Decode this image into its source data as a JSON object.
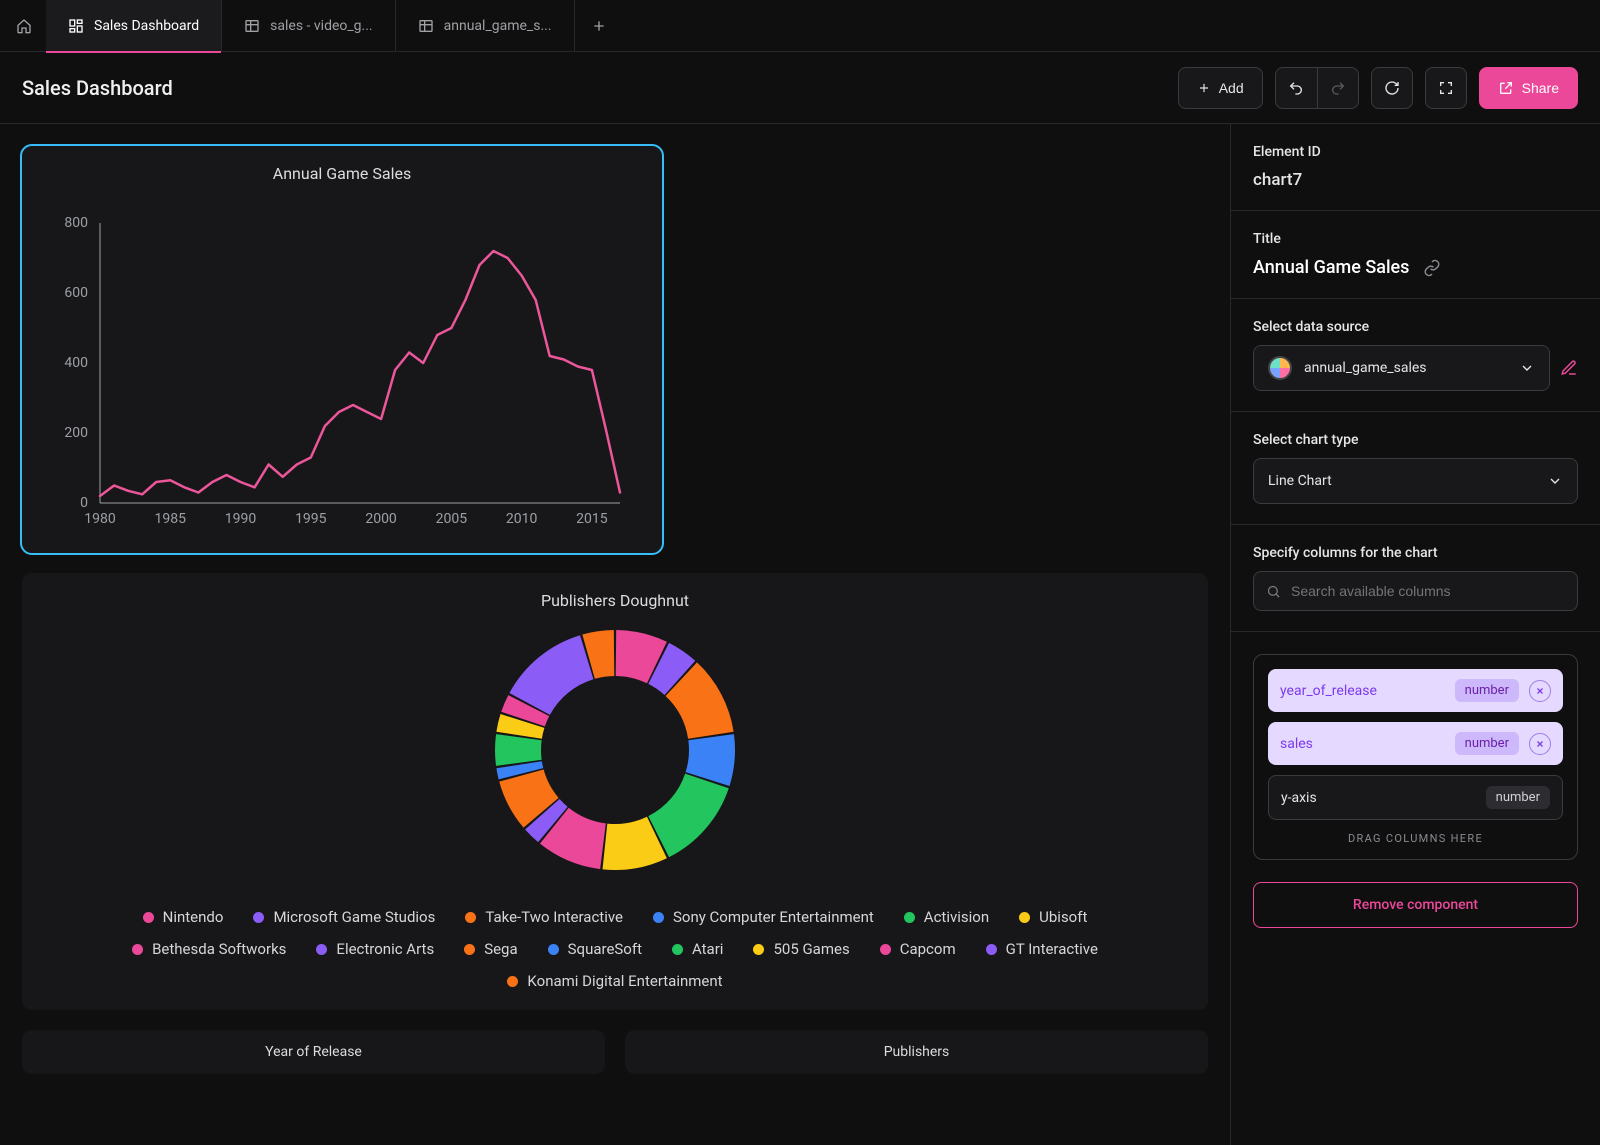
{
  "tabs": {
    "home_icon": "home-icon",
    "items": [
      {
        "label": "Sales Dashboard",
        "icon": "dashboard-icon",
        "active": true
      },
      {
        "label": "sales - video_g...",
        "icon": "table-icon",
        "active": false
      },
      {
        "label": "annual_game_s...",
        "icon": "table-icon",
        "active": false
      }
    ],
    "add_label": "+"
  },
  "header": {
    "title": "Sales Dashboard",
    "add_label": "Add",
    "share_label": "Share"
  },
  "sidebar": {
    "element_id": {
      "label": "Element ID",
      "value": "chart7"
    },
    "title": {
      "label": "Title",
      "value": "Annual Game Sales"
    },
    "datasource": {
      "label": "Select data source",
      "value": "annual_game_sales"
    },
    "charttype": {
      "label": "Select chart type",
      "value": "Line Chart"
    },
    "columns": {
      "label": "Specify columns for the chart",
      "search_placeholder": "Search available columns"
    },
    "well": {
      "chips": [
        {
          "name": "year_of_release",
          "type": "number"
        },
        {
          "name": "sales",
          "type": "number"
        }
      ],
      "axis": {
        "name": "y-axis",
        "type": "number"
      },
      "drag_hint": "DRAG COLUMNS HERE"
    },
    "remove_label": "Remove component"
  },
  "charts": {
    "line": {
      "title": "Annual Game Sales",
      "y_ticks": [
        0,
        200,
        400,
        600,
        800
      ],
      "x_ticks": [
        1980,
        1985,
        1990,
        1995,
        2000,
        2005,
        2010,
        2015
      ]
    },
    "doughnut": {
      "title": "Publishers Doughnut",
      "legend": [
        {
          "label": "Nintendo",
          "color": "#ec4899"
        },
        {
          "label": "Microsoft Game Studios",
          "color": "#8b5cf6"
        },
        {
          "label": "Take-Two Interactive",
          "color": "#f97316"
        },
        {
          "label": "Sony Computer Entertainment",
          "color": "#3b82f6"
        },
        {
          "label": "Activision",
          "color": "#22c55e"
        },
        {
          "label": "Ubisoft",
          "color": "#facc15"
        },
        {
          "label": "Bethesda Softworks",
          "color": "#ec4899"
        },
        {
          "label": "Electronic Arts",
          "color": "#8b5cf6"
        },
        {
          "label": "Sega",
          "color": "#f97316"
        },
        {
          "label": "SquareSoft",
          "color": "#3b82f6"
        },
        {
          "label": "Atari",
          "color": "#22c55e"
        },
        {
          "label": "505 Games",
          "color": "#facc15"
        },
        {
          "label": "Capcom",
          "color": "#ec4899"
        },
        {
          "label": "GT Interactive",
          "color": "#8b5cf6"
        },
        {
          "label": "Konami Digital Entertainment",
          "color": "#f97316"
        }
      ]
    },
    "bottom": {
      "left": "Year of Release",
      "right": "Publishers"
    }
  },
  "chart_data": [
    {
      "type": "line",
      "title": "Annual Game Sales",
      "xlabel": "",
      "ylabel": "",
      "ylim": [
        0,
        800
      ],
      "x": [
        1980,
        1981,
        1982,
        1983,
        1984,
        1985,
        1986,
        1987,
        1988,
        1989,
        1990,
        1991,
        1992,
        1993,
        1994,
        1995,
        1996,
        1997,
        1998,
        1999,
        2000,
        2001,
        2002,
        2003,
        2004,
        2005,
        2006,
        2007,
        2008,
        2009,
        2010,
        2011,
        2012,
        2013,
        2014,
        2015,
        2016,
        2017
      ],
      "values": [
        20,
        50,
        35,
        25,
        60,
        65,
        45,
        30,
        60,
        80,
        60,
        45,
        110,
        75,
        110,
        130,
        220,
        260,
        280,
        260,
        240,
        380,
        430,
        400,
        480,
        500,
        580,
        680,
        720,
        700,
        650,
        580,
        420,
        410,
        390,
        380,
        210,
        30
      ]
    },
    {
      "type": "pie",
      "title": "Publishers Doughnut",
      "series": [
        {
          "name": "Nintendo",
          "value": 8,
          "color": "#ec4899"
        },
        {
          "name": "Microsoft Game Studios",
          "value": 5,
          "color": "#8b5cf6"
        },
        {
          "name": "Take-Two Interactive",
          "value": 12,
          "color": "#f97316"
        },
        {
          "name": "Sony Computer Entertainment",
          "value": 8,
          "color": "#3b82f6"
        },
        {
          "name": "Activision",
          "value": 14,
          "color": "#22c55e"
        },
        {
          "name": "Ubisoft",
          "value": 10,
          "color": "#facc15"
        },
        {
          "name": "Bethesda Softworks",
          "value": 10,
          "color": "#ec4899"
        },
        {
          "name": "Electronic Arts",
          "value": 3,
          "color": "#8b5cf6"
        },
        {
          "name": "Sega",
          "value": 8,
          "color": "#f97316"
        },
        {
          "name": "SquareSoft",
          "value": 2,
          "color": "#3b82f6"
        },
        {
          "name": "Atari",
          "value": 5,
          "color": "#22c55e"
        },
        {
          "name": "505 Games",
          "value": 3,
          "color": "#facc15"
        },
        {
          "name": "Capcom",
          "value": 3,
          "color": "#ec4899"
        },
        {
          "name": "GT Interactive",
          "value": 14,
          "color": "#8b5cf6"
        },
        {
          "name": "Konami Digital Entertainment",
          "value": 5,
          "color": "#f97316"
        }
      ]
    }
  ]
}
